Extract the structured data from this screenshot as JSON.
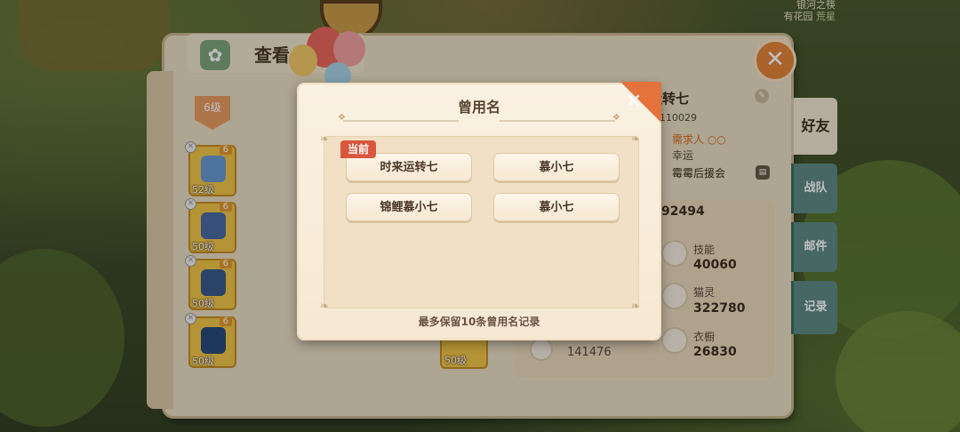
{
  "top_label": {
    "line1": "银河之筷",
    "line2": "有花园",
    "line2_tag": "荒星"
  },
  "page": {
    "title": "查看"
  },
  "level_badge": "6级",
  "equipment": [
    {
      "level": "6",
      "label": "52级"
    },
    {
      "level": "6",
      "label": "50级"
    },
    {
      "level": "6",
      "label": "50级"
    },
    {
      "level": "6",
      "label": "50级"
    }
  ],
  "equip_mid": {
    "label": "50级"
  },
  "player": {
    "name": "时来运转七",
    "id": "110029",
    "tag": "需求人 ○○",
    "luck": "幸运",
    "team": "霉霉后援会",
    "score": "92494"
  },
  "stats": [
    {
      "label": "技能",
      "value": "40060"
    },
    {
      "label": "猫灵",
      "value": "322780"
    },
    {
      "label": "衣橱",
      "value": "26830"
    }
  ],
  "left_stat": {
    "value": "141476"
  },
  "side_tabs": [
    {
      "label": "好友"
    },
    {
      "label": "战队"
    },
    {
      "label": "邮件"
    },
    {
      "label": "记录"
    }
  ],
  "modal": {
    "title": "曾用名",
    "current_badge": "当前",
    "names": [
      "时来运转七",
      "慕小七",
      "锦鲤慕小七",
      "慕小七"
    ],
    "footer": "最多保留10条曾用名记录"
  },
  "colors": {
    "accent": "#e5713b",
    "badge": "#d9573e",
    "side_tab": "#5e8a86"
  }
}
